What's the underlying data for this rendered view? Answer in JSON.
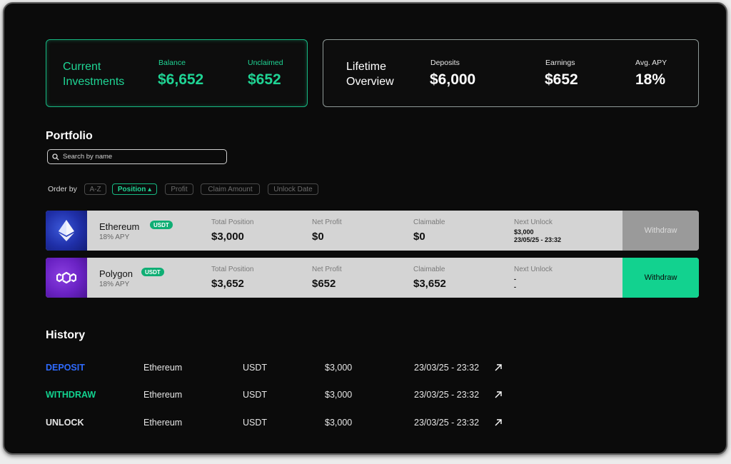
{
  "current": {
    "title_line1": "Current",
    "title_line2": "Investments",
    "balance_label": "Balance",
    "balance_value": "$6,652",
    "unclaimed_label": "Unclaimed",
    "unclaimed_value": "$652"
  },
  "lifetime": {
    "title_line1": "Lifetime",
    "title_line2": "Overview",
    "deposits_label": "Deposits",
    "deposits_value": "$6,000",
    "earnings_label": "Earnings",
    "earnings_value": "$652",
    "apy_label": "Avg. APY",
    "apy_value": "18%"
  },
  "portfolio": {
    "title": "Portfolio",
    "search_placeholder": "Search by name",
    "order_label": "Order by",
    "order_options": [
      "A-Z",
      "Position ▴",
      "Profit",
      "Claim Amount",
      "Unlock Date"
    ],
    "active_order": "Position",
    "columns": {
      "total_position": "Total Position",
      "net_profit": "Net Profit",
      "claimable": "Claimable",
      "next_unlock": "Next Unlock"
    },
    "assets": [
      {
        "name": "Ethereum",
        "badge": "USDT",
        "apy": "18% APY",
        "total_position": "$3,000",
        "net_profit": "$0",
        "claimable": "$0",
        "next_unlock_line1": "$3,000",
        "next_unlock_line2": "23/05/25 - 23:32",
        "withdraw_label": "Withdraw",
        "logo_icon": "ethereum-icon"
      },
      {
        "name": "Polygon",
        "badge": "USDT",
        "apy": "18% APY",
        "total_position": "$3,652",
        "net_profit": "$652",
        "claimable": "$3,652",
        "next_unlock_line1": "-",
        "next_unlock_line2": "-",
        "withdraw_label": "Withdraw",
        "logo_icon": "polygon-icon"
      }
    ]
  },
  "history": {
    "title": "History",
    "rows": [
      {
        "type": "DEPOSIT",
        "asset": "Ethereum",
        "token": "USDT",
        "amount": "$3,000",
        "date": "23/03/25 - 23:32"
      },
      {
        "type": "WITHDRAW",
        "asset": "Ethereum",
        "token": "USDT",
        "amount": "$3,000",
        "date": "23/03/25 - 23:32"
      },
      {
        "type": "UNLOCK",
        "asset": "Ethereum",
        "token": "USDT",
        "amount": "$3,000",
        "date": "23/03/25 - 23:32"
      }
    ]
  },
  "colors": {
    "accent_green": "#1fd494",
    "deposit_blue": "#2f6bff",
    "withdraw_green": "#12d28f",
    "background": "#0b0b0b"
  }
}
